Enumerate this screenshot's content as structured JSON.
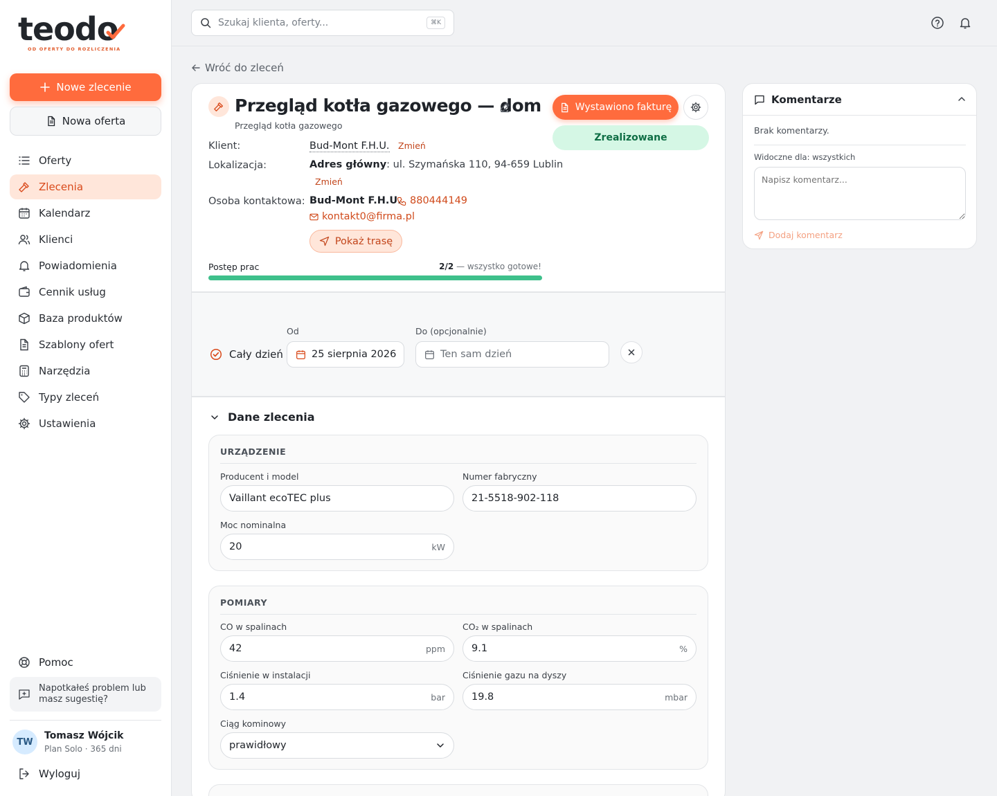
{
  "brand": {
    "name": "teodo",
    "tagline": "OD OFERTY DO ROZLICZENIA",
    "accent": "#ff6b3d"
  },
  "sidebar": {
    "new_order": "Nowe zlecenie",
    "new_offer": "Nowa oferta",
    "items": [
      {
        "label": "Oferty",
        "icon": "list-icon"
      },
      {
        "label": "Zlecenia",
        "icon": "hammer-icon",
        "active": true
      },
      {
        "label": "Kalendarz",
        "icon": "calendar-icon"
      },
      {
        "label": "Klienci",
        "icon": "users-icon"
      },
      {
        "label": "Powiadomienia",
        "icon": "bell-icon"
      },
      {
        "label": "Cennik usług",
        "icon": "wallet-icon"
      },
      {
        "label": "Baza produktów",
        "icon": "box-icon"
      },
      {
        "label": "Szablony ofert",
        "icon": "document-icon"
      },
      {
        "label": "Narzędzia",
        "icon": "calculator-icon"
      },
      {
        "label": "Typy zleceń",
        "icon": "tag-icon"
      },
      {
        "label": "Ustawienia",
        "icon": "gear-icon"
      }
    ],
    "help": "Pomoc",
    "feedback": "Napotkałeś problem lub masz sugestię?",
    "user": {
      "initials": "TW",
      "name": "Tomasz Wójcik",
      "plan": "Plan Solo · 365 dni"
    },
    "logout": "Wyloguj"
  },
  "topbar": {
    "search_placeholder": "Szukaj klienta, oferty...",
    "shortcut": "⌘K"
  },
  "back_link": "Wróć do zleceń",
  "order": {
    "title": "Przegląd kotła gazowego — dom",
    "subtitle": "Przegląd kotła gazowego",
    "status_button": "Wystawiono fakturę",
    "status_pill": "Zrealizowane",
    "client_label": "Klient:",
    "client": "Bud-Mont F.H.U.",
    "change": "Zmień",
    "location_label": "Lokalizacja:",
    "location_prefix": "Adres główny",
    "location": ": ul. Szymańska 110, 94-659 Lublin",
    "contact_label": "Osoba kontaktowa:",
    "contact_name": "Bud-Mont F.H.U.",
    "phone": "880444149",
    "email": "kontakt0@firma.pl",
    "route_button": "Pokaż trasę",
    "progress_label": "Postęp prac",
    "progress_count": "2/2",
    "progress_note": " — wszystko gotowe!",
    "progress_fraction": 1.0
  },
  "dates": {
    "all_day": "Cały dzień",
    "from_label": "Od",
    "from_value": "25 sierpnia 2026",
    "to_label": "Do (opcjonalnie)",
    "to_placeholder": "Ten sam dzień"
  },
  "details": {
    "title": "Dane zlecenia",
    "device": {
      "title": "URZĄDZENIE",
      "model_label": "Producent i model",
      "model": "Vaillant ecoTEC plus",
      "serial_label": "Numer fabryczny",
      "serial": "21-5518-902-118",
      "power_label": "Moc nominalna",
      "power": "20",
      "power_unit": "kW"
    },
    "measurements": {
      "title": "POMIARY",
      "co_label": "CO w spalinach",
      "co": "42",
      "co_unit": "ppm",
      "co2_label": "CO₂ w spalinach",
      "co2": "9.1",
      "co2_unit": "%",
      "pressure_label": "Ciśnienie w instalacji",
      "pressure": "1.4",
      "pressure_unit": "bar",
      "gas_label": "Ciśnienie gazu na dyszy",
      "gas": "19.8",
      "gas_unit": "mbar",
      "draft_label": "Ciąg kominowy",
      "draft": "prawidłowy"
    }
  },
  "comments": {
    "title": "Komentarze",
    "empty": "Brak komentarzy.",
    "visibility": "Widoczne dla: wszystkich",
    "placeholder": "Napisz komentarz...",
    "send": "Dodaj komentarz"
  }
}
